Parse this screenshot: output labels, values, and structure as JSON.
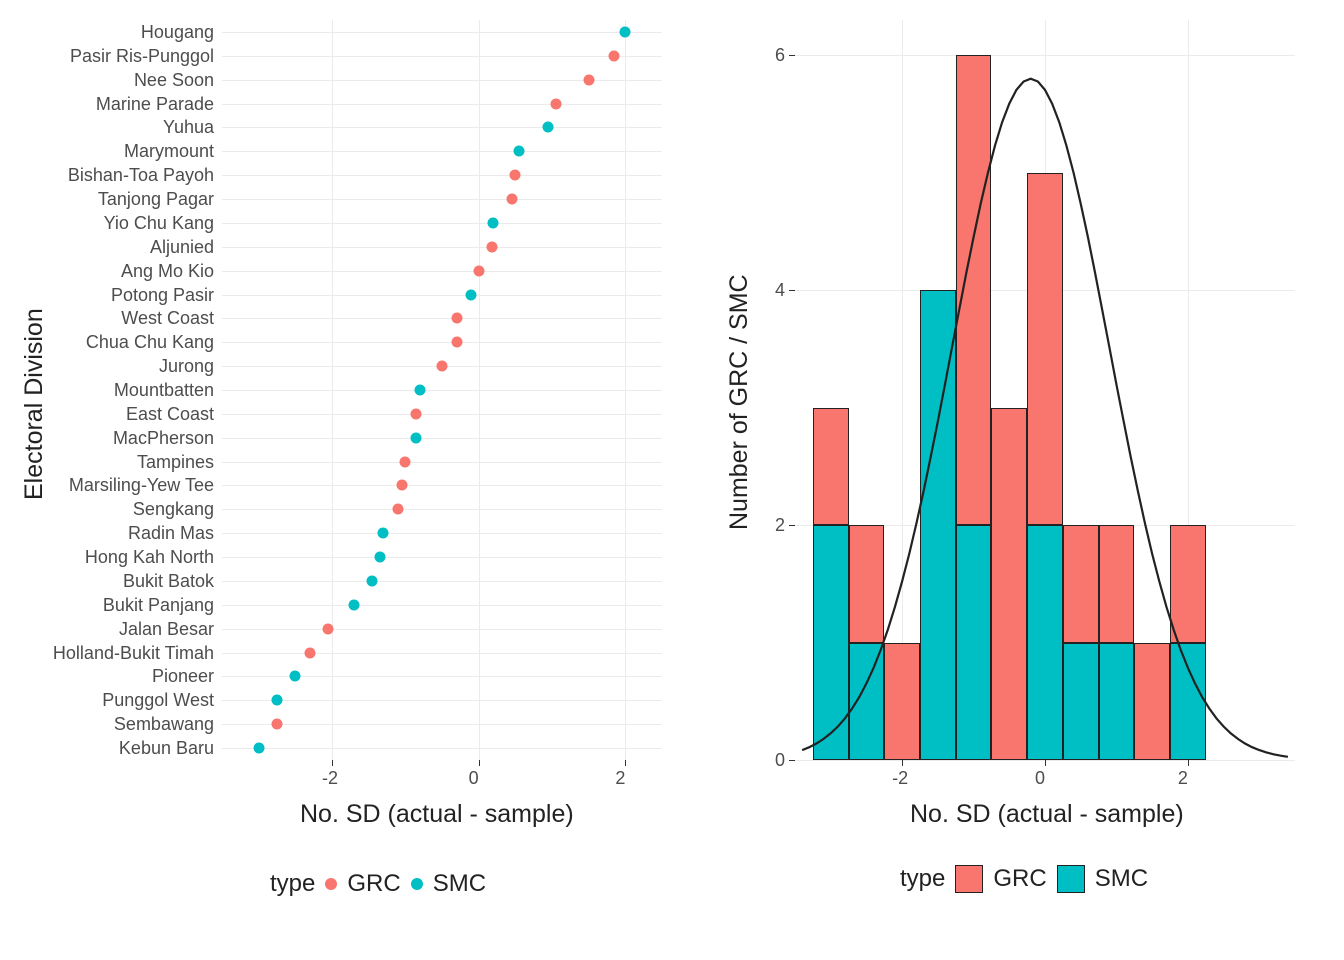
{
  "chart_data": [
    {
      "type": "scatter",
      "xlabel": "No. SD (actual - sample)",
      "ylabel": "Electoral Division",
      "xlim": [
        -3.5,
        2.5
      ],
      "x_ticks": [
        -2,
        0,
        2
      ],
      "legend_title": "type",
      "legend_levels": [
        "GRC",
        "SMC"
      ],
      "points": [
        {
          "division": "Hougang",
          "type": "SMC",
          "value": 2.0
        },
        {
          "division": "Pasir Ris-Punggol",
          "type": "GRC",
          "value": 1.85
        },
        {
          "division": "Nee Soon",
          "type": "GRC",
          "value": 1.5
        },
        {
          "division": "Marine Parade",
          "type": "GRC",
          "value": 1.05
        },
        {
          "division": "Yuhua",
          "type": "SMC",
          "value": 0.95
        },
        {
          "division": "Marymount",
          "type": "SMC",
          "value": 0.55
        },
        {
          "division": "Bishan-Toa Payoh",
          "type": "GRC",
          "value": 0.5
        },
        {
          "division": "Tanjong Pagar",
          "type": "GRC",
          "value": 0.45
        },
        {
          "division": "Yio Chu Kang",
          "type": "SMC",
          "value": 0.2
        },
        {
          "division": "Aljunied",
          "type": "GRC",
          "value": 0.18
        },
        {
          "division": "Ang Mo Kio",
          "type": "GRC",
          "value": 0.0
        },
        {
          "division": "Potong Pasir",
          "type": "SMC",
          "value": -0.1
        },
        {
          "division": "West Coast",
          "type": "GRC",
          "value": -0.3
        },
        {
          "division": "Chua Chu Kang",
          "type": "GRC",
          "value": -0.3
        },
        {
          "division": "Jurong",
          "type": "GRC",
          "value": -0.5
        },
        {
          "division": "Mountbatten",
          "type": "SMC",
          "value": -0.8
        },
        {
          "division": "East Coast",
          "type": "GRC",
          "value": -0.85
        },
        {
          "division": "MacPherson",
          "type": "SMC",
          "value": -0.85
        },
        {
          "division": "Tampines",
          "type": "GRC",
          "value": -1.0
        },
        {
          "division": "Marsiling-Yew Tee",
          "type": "GRC",
          "value": -1.05
        },
        {
          "division": "Sengkang",
          "type": "GRC",
          "value": -1.1
        },
        {
          "division": "Radin Mas",
          "type": "SMC",
          "value": -1.3
        },
        {
          "division": "Hong Kah North",
          "type": "SMC",
          "value": -1.35
        },
        {
          "division": "Bukit Batok",
          "type": "SMC",
          "value": -1.45
        },
        {
          "division": "Bukit Panjang",
          "type": "SMC",
          "value": -1.7
        },
        {
          "division": "Jalan Besar",
          "type": "GRC",
          "value": -2.05
        },
        {
          "division": "Holland-Bukit Timah",
          "type": "GRC",
          "value": -2.3
        },
        {
          "division": "Pioneer",
          "type": "SMC",
          "value": -2.5
        },
        {
          "division": "Punggol West",
          "type": "SMC",
          "value": -2.75
        },
        {
          "division": "Sembawang",
          "type": "GRC",
          "value": -2.75
        },
        {
          "division": "Kebun Baru",
          "type": "SMC",
          "value": -3.0
        }
      ]
    },
    {
      "type": "histogram",
      "xlabel": "No. SD (actual - sample)",
      "ylabel": "Number of GRC / SMC",
      "xlim": [
        -3.5,
        3.5
      ],
      "ylim": [
        0,
        6.3
      ],
      "x_ticks": [
        -2,
        0,
        2
      ],
      "y_ticks": [
        0,
        2,
        4,
        6
      ],
      "legend_title": "type",
      "legend_levels": [
        "GRC",
        "SMC"
      ],
      "bin_width": 0.5,
      "bars": [
        {
          "x_left": -3.25,
          "total": 3,
          "smc": 2,
          "grc": 1
        },
        {
          "x_left": -2.75,
          "total": 2,
          "smc": 1,
          "grc": 1
        },
        {
          "x_left": -2.25,
          "total": 1,
          "smc": 0,
          "grc": 1
        },
        {
          "x_left": -1.75,
          "total": 4,
          "smc": 4,
          "grc": 0
        },
        {
          "x_left": -1.25,
          "total": 6,
          "smc": 2,
          "grc": 4
        },
        {
          "x_left": -0.75,
          "total": 3,
          "smc": 0,
          "grc": 3
        },
        {
          "x_left": -0.25,
          "total": 5,
          "smc": 2,
          "grc": 3
        },
        {
          "x_left": 0.25,
          "total": 2,
          "smc": 1,
          "grc": 1
        },
        {
          "x_left": 0.75,
          "total": 2,
          "smc": 1,
          "grc": 1
        },
        {
          "x_left": 1.25,
          "total": 1,
          "smc": 0,
          "grc": 1
        },
        {
          "x_left": 1.75,
          "total": 2,
          "smc": 1,
          "grc": 1
        }
      ],
      "density_curve": {
        "peak_y": 5.8,
        "peak_x": -0.2,
        "left_x": -3.4,
        "right_x": 3.4
      }
    }
  ],
  "labels": {
    "grc": "GRC",
    "smc": "SMC",
    "type": "type"
  }
}
